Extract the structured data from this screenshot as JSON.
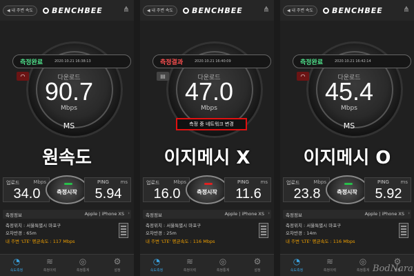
{
  "panels": [
    {
      "nearby_button": "◀ 내 주변 속도",
      "logo": "BENCHBEE",
      "status_label": "측정완료",
      "status_color": "#4fe08a",
      "timestamp": "2020.10.21 16:38:13",
      "download_label": "다운로드",
      "download": "90.7",
      "unit": "Mbps",
      "ms": "MS",
      "network_note": "",
      "caption": "원속도",
      "upload_label": "업로드",
      "upload_unit": "Mbps",
      "upload": "34.0",
      "start_label": "측정시작",
      "start_dot_color": "#27c04a",
      "ping_label": "PING",
      "ping_unit": "ms",
      "ping": "5.94",
      "info_title": "측정정보",
      "device": "Apple | iPhone XS",
      "location": "측정위치 : 서울특별시 마포구",
      "error_radius": "오차반경 : 65m",
      "average": "내 주변 'LTE' 평균속도 : 117 Mbps",
      "tabs": [
        "속도측정",
        "측정이력",
        "측정통계",
        "설정"
      ]
    },
    {
      "nearby_button": "◀ 내 주변 속도",
      "logo": "BENCHBEE",
      "status_label": "측정결과",
      "status_color": "#ff5050",
      "timestamp": "2020.10.21 16:40:09",
      "download_label": "다운로드",
      "download": "47.0",
      "unit": "Mbps",
      "ms": "",
      "network_note": "측정 중 네트워크 변경",
      "caption": "이지메시 X",
      "upload_label": "업로드",
      "upload_unit": "Mbps",
      "upload": "16.0",
      "start_label": "측정시작",
      "start_dot_color": "#e02020",
      "ping_label": "PING",
      "ping_unit": "ms",
      "ping": "11.6",
      "info_title": "측정정보",
      "device": "Apple | iPhone XS",
      "location": "측정위치 : 서울특별시 마포구",
      "error_radius": "오차반경 : 25m",
      "average": "내 주변 'LTE' 평균속도 : 116 Mbps",
      "tabs": [
        "속도측정",
        "측정이력",
        "측정통계",
        "설정"
      ]
    },
    {
      "nearby_button": "◀ 내 주변 속도",
      "logo": "BENCHBEE",
      "status_label": "측정완료",
      "status_color": "#4fe08a",
      "timestamp": "2020.10.21 16:42:14",
      "download_label": "다운로드",
      "download": "45.4",
      "unit": "Mbps",
      "ms": "MS",
      "network_note": "",
      "caption": "이지메시 O",
      "upload_label": "업로드",
      "upload_unit": "Mbps",
      "upload": "23.8",
      "start_label": "측정시작",
      "start_dot_color": "#27c04a",
      "ping_label": "PING",
      "ping_unit": "ms",
      "ping": "5.92",
      "info_title": "측정정보",
      "device": "Apple | iPhone XS",
      "location": "측정위치 : 서울특별시 마포구",
      "error_radius": "오차반경 : 14m",
      "average": "내 주변 'LTE' 평균속도 : 116 Mbps",
      "tabs": [
        "속도측정",
        "측정이력",
        "측정통계",
        "설정"
      ]
    }
  ],
  "watermark": "BodNara"
}
